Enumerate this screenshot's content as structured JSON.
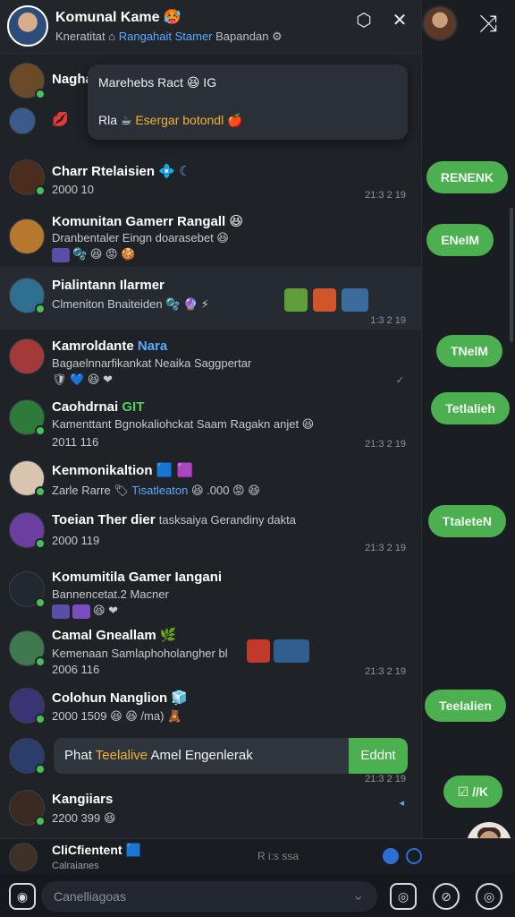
{
  "header": {
    "title": "Komunal Kame 🥵",
    "subtitle_pre": "Kneratitat ⌂",
    "subtitle_highlight": "Rangahait Stamer",
    "subtitle_post": "Bapandan"
  },
  "popup": {
    "line1": "Marehebs Ract 😆 IG",
    "line2_pre": "Rla ☕",
    "line2_orange": "Esergar botondl",
    "line2_post": "🍎"
  },
  "chats": [
    {
      "name": "Nagha",
      "preview": "",
      "time": "",
      "avatar": "#6b4a2a"
    },
    {
      "name": "💋",
      "preview": "",
      "time": "",
      "avatar": "#3a5b8c"
    },
    {
      "name": "Charr Rtelaisien",
      "name_blue": "💠 ☾",
      "preview": "2000 10",
      "time": "21:3 2 19",
      "avatar": "#4a2d1d"
    },
    {
      "name": "Komunitan Gamerr Rangall 😆",
      "preview": "Dranbentaler Eingn doarasebet 😆",
      "time": "",
      "avatar": "#b5782d"
    },
    {
      "name": "Pialintann Ilarmer",
      "preview": "Clmeniton Bnaiteiden 🫧 🔮 ⚡",
      "time": "1:3 2 19",
      "avatar": "#2f6f8f"
    },
    {
      "name": "Kamroldante",
      "name_blue": "Nara",
      "preview": "Bagaelnnarfikankat Neaika Saggpertar",
      "time": "",
      "avatar": "#a23a3a"
    },
    {
      "name": "Caohdrnai",
      "name_green": "GIT",
      "preview": "Kamenttant Bgnokaliohckat Saam Ragakn anjet 😆",
      "time": "21:3 2 19",
      "sub": "2011 116",
      "avatar": "#2d7a3a"
    },
    {
      "name": "Kenmonikaltion",
      "name_blue": "🟦 🟪",
      "preview": "Zarle Rarre 🏷",
      "preview_blue": "Tisatleaton",
      "preview_post": "😆 .000 😡 😆",
      "time": "",
      "avatar": "#d9c4b0"
    },
    {
      "name": "Toeian Ther dier",
      "preview_inline": "tasksaiya Gerandiny dakta",
      "preview": "2000 119",
      "time": "21:3 2 19",
      "avatar": "#6a3fa0"
    },
    {
      "name": "Komumitila Gamer Iangani",
      "preview": "Bannencetat.2 Macner",
      "time": "",
      "avatar": "#202830"
    },
    {
      "name": "Camal Gneallam",
      "name_green": "🌿",
      "preview": "Kemenaan Samlaphoholangher bl",
      "sub": "2006 116",
      "time": "21:3 2 19",
      "avatar": "#3f7a4f"
    },
    {
      "name": "Colohun Nanglion",
      "name_blue": "🧊",
      "preview": "2000 1509 😆 😆 /ma) 🧸",
      "time": "",
      "avatar": "#3a3475"
    },
    {
      "name": "",
      "preview": "",
      "time": "21:3 2 19",
      "avatar": "#2b3d6a"
    },
    {
      "name": "Kangiiars",
      "preview": "2200 399 😆",
      "time": "",
      "avatar": "#3a2a22"
    }
  ],
  "inline_bubble": {
    "pre": "Phat",
    "orange": "Teelalive",
    "post": "Amel Engenlerak",
    "button": "Eddnt"
  },
  "right_bubbles": [
    "RENENK",
    "ENeIM",
    "TNelM",
    "Tetlalieh",
    "TtaleteN",
    "Teelalien",
    "☑ //K"
  ],
  "footer_row": {
    "name": "CliCfientent 🟦",
    "sub": "Calraianes",
    "middle": "R i:s ssa"
  },
  "composer": {
    "placeholder": "Canelliagoas"
  },
  "colors": {
    "accent_green": "#4caf50",
    "link_blue": "#5aa8ff",
    "online": "#45c157"
  }
}
